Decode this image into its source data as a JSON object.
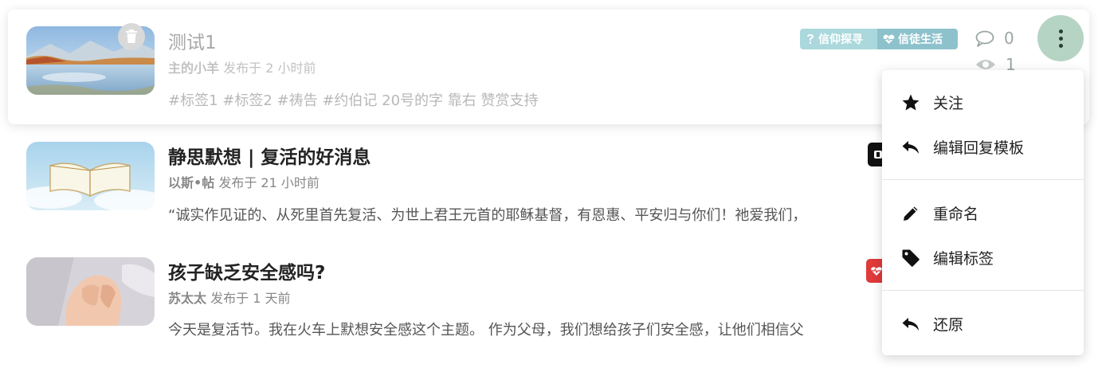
{
  "topics": [
    {
      "title": "测试1",
      "author": "主的小羊",
      "posted": " 发布于 2 小时前",
      "teaser": "#标签1 #标签2 #祷告 #约伯记 20号的字 靠右 赞赏支持",
      "tags": [
        "信仰探寻",
        "信徒生活"
      ],
      "replies": "0",
      "views": "1"
    },
    {
      "title": "静思默想 | 复活的好消息",
      "author": "以斯•帖",
      "posted": " 发布于 21 小时前",
      "teaser": "“诚实作见证的、从死里首先复活、为世上君王元首的耶稣基督，有恩惠、平安归与你们！祂爱我们，"
    },
    {
      "title": "孩子缺乏安全感吗?",
      "author": "苏太太",
      "posted": " 发布于 1 天前",
      "teaser": "今天是复活节。我在火车上默想安全感这个主题。 作为父母，我们想给孩子们安全感，让他们相信父"
    }
  ],
  "menu": {
    "follow": "关注",
    "edit_reply_template": "编辑回复模板",
    "rename": "重命名",
    "edit_tags": "编辑标签",
    "restore": "还原"
  },
  "colors": {
    "tag1": "#aad8dc",
    "tag2": "#8dc2cc",
    "kebab_bg": "#b5d4c4",
    "edge_badge_black": "#111111",
    "edge_badge_red": "#e03a3a"
  },
  "icons": [
    "trash-icon",
    "question-icon",
    "heart-pulse-icon",
    "comment-icon",
    "eye-icon",
    "kebab-icon",
    "star-icon",
    "reply-icon",
    "pencil-icon",
    "tag-icon",
    "undo-icon"
  ]
}
